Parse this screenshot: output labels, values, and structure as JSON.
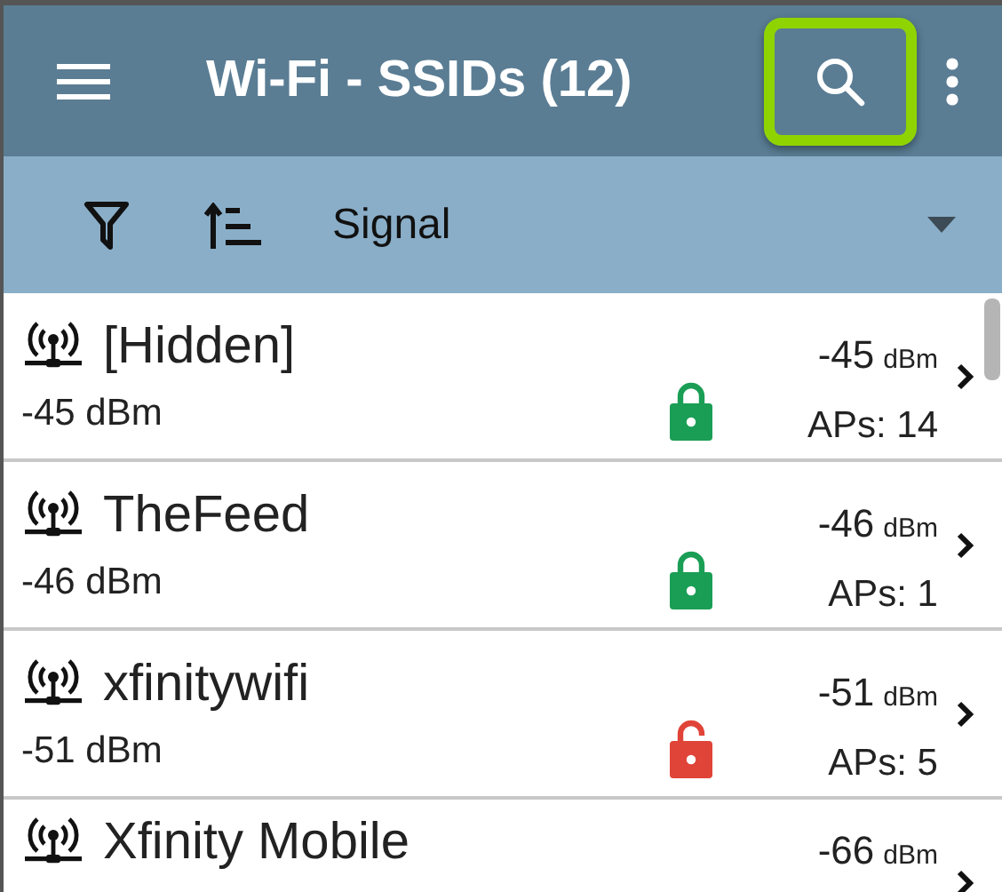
{
  "app_bar": {
    "title": "Wi-Fi - SSIDs (12)",
    "search_highlighted": true
  },
  "filter_bar": {
    "sort_label": "Signal"
  },
  "ssids": [
    {
      "name": "[Hidden]",
      "signal": "-45",
      "unit": "dBm",
      "subtitle": "-45 dBm",
      "locked": true,
      "aps": "APs: 14"
    },
    {
      "name": "TheFeed",
      "signal": "-46",
      "unit": "dBm",
      "subtitle": "-46 dBm",
      "locked": true,
      "aps": "APs: 1"
    },
    {
      "name": "xfinitywifi",
      "signal": "-51",
      "unit": "dBm",
      "subtitle": "-51 dBm",
      "locked": false,
      "aps": "APs: 5"
    },
    {
      "name": "Xfinity Mobile",
      "signal": "-66",
      "unit": "dBm"
    }
  ]
}
